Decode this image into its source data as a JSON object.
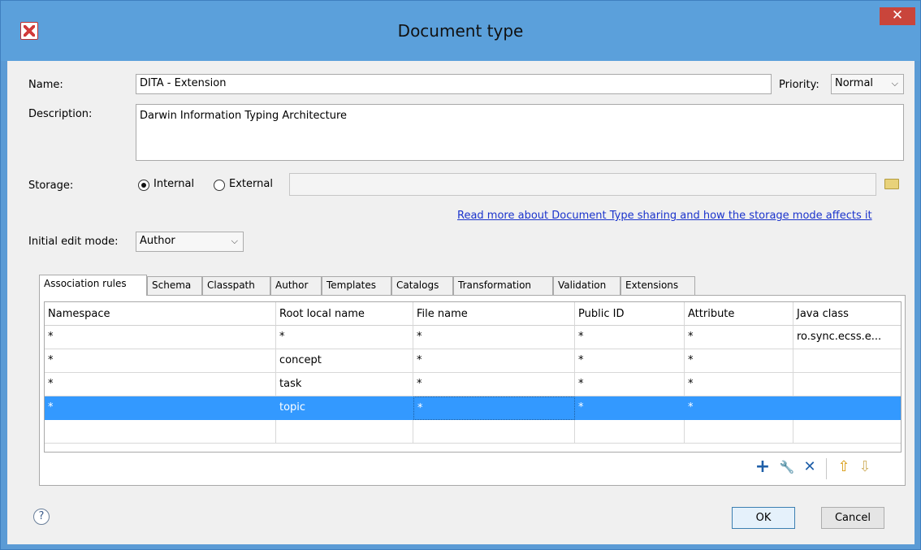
{
  "window": {
    "title": "Document type",
    "close_glyph": "✕"
  },
  "form": {
    "name_label": "Name:",
    "name_value": "DITA - Extension",
    "priority_label": "Priority:",
    "priority_value": "Normal",
    "description_label": "Description:",
    "description_value": "Darwin Information Typing Architecture",
    "storage_label": "Storage:",
    "storage_internal": "Internal",
    "storage_external": "External",
    "storage_selected": "Internal",
    "storage_path": "",
    "storage_link": "Read more about Document Type sharing and how the storage mode affects it",
    "edit_mode_label": "Initial edit mode:",
    "edit_mode_value": "Author"
  },
  "tabs": [
    {
      "label": "Association rules",
      "active": true
    },
    {
      "label": "Schema"
    },
    {
      "label": "Classpath"
    },
    {
      "label": "Author"
    },
    {
      "label": "Templates"
    },
    {
      "label": "Catalogs"
    },
    {
      "label": "Transformation"
    },
    {
      "label": "Validation"
    },
    {
      "label": "Extensions"
    }
  ],
  "table": {
    "columns": [
      "Namespace",
      "Root local name",
      "File name",
      "Public ID",
      "Attribute",
      "Java class"
    ],
    "rows": [
      [
        "*",
        "*",
        "*",
        "*",
        "*",
        "ro.sync.ecss.e..."
      ],
      [
        "*",
        "concept",
        "*",
        "*",
        "*",
        ""
      ],
      [
        "*",
        "task",
        "*",
        "*",
        "*",
        ""
      ],
      [
        "*",
        "topic",
        "*",
        "*",
        "*",
        ""
      ]
    ],
    "selected_row": 3
  },
  "actions": {
    "add": "+",
    "edit": "🔧",
    "remove": "✕",
    "move_up": "⇧",
    "move_down": "⇩"
  },
  "buttons": {
    "ok": "OK",
    "cancel": "Cancel",
    "help": "?"
  },
  "colors": {
    "title_bar": "#5ba0db",
    "selection": "#3399ff",
    "link": "#1a33cc",
    "close": "#c9453b"
  }
}
